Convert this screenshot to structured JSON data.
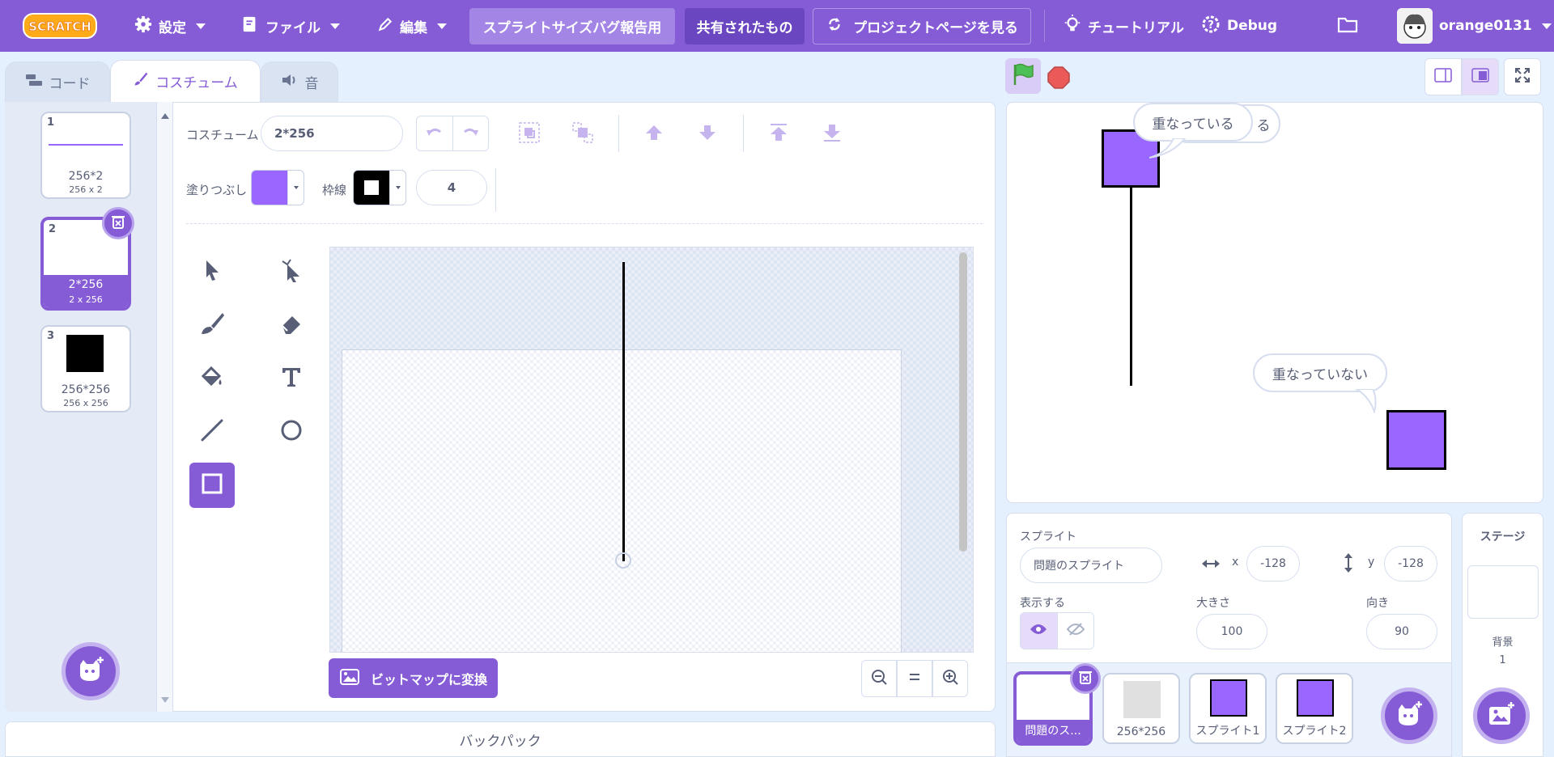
{
  "menubar": {
    "logo": "SCRATCH",
    "settings": "設定",
    "file": "ファイル",
    "edit": "編集",
    "project_title": "スプライトサイズバグ報告用",
    "shared": "共有されたもの",
    "project_page": "プロジェクトページを見る",
    "tutorials": "チュートリアル",
    "debug": "Debug",
    "username": "orange0131"
  },
  "tabs": {
    "code": "コード",
    "costumes": "コスチューム",
    "sounds": "音"
  },
  "costumes": [
    {
      "num": "1",
      "name": "256*2",
      "size": "256 x 2"
    },
    {
      "num": "2",
      "name": "2*256",
      "size": "2 x 256"
    },
    {
      "num": "3",
      "name": "256*256",
      "size": "256 x 256"
    }
  ],
  "paint": {
    "costume_label": "コスチューム",
    "costume_name": "2*256",
    "fill_label": "塗りつぶし",
    "outline_label": "枠線",
    "outline_width": "4",
    "fill_color": "#9966ff",
    "outline_color": "#000000",
    "convert_button": "ビットマップに変換"
  },
  "backpack": "バックパック",
  "stage": {
    "bubble_1": "重なっている",
    "bubble_1_back": "る",
    "bubble_2": "重なっていない"
  },
  "sprite_info": {
    "sprite_label": "スプライト",
    "sprite_name": "問題のスプライト",
    "x_label": "x",
    "x_value": "-128",
    "y_label": "y",
    "y_value": "-128",
    "show_label": "表示する",
    "size_label": "大きさ",
    "size_value": "100",
    "direction_label": "向き",
    "direction_value": "90"
  },
  "sprites": [
    {
      "name": "問題のス..."
    },
    {
      "name": "256*256"
    },
    {
      "name": "スプライト1"
    },
    {
      "name": "スプライト2"
    }
  ],
  "stage_target": {
    "title": "ステージ",
    "backdrop_label": "背景",
    "backdrop_count": "1"
  },
  "colors": {
    "accent": "#855cd6",
    "sprite_fill": "#9966ff",
    "stop": "#ec5959",
    "go": "#4cbf56"
  }
}
